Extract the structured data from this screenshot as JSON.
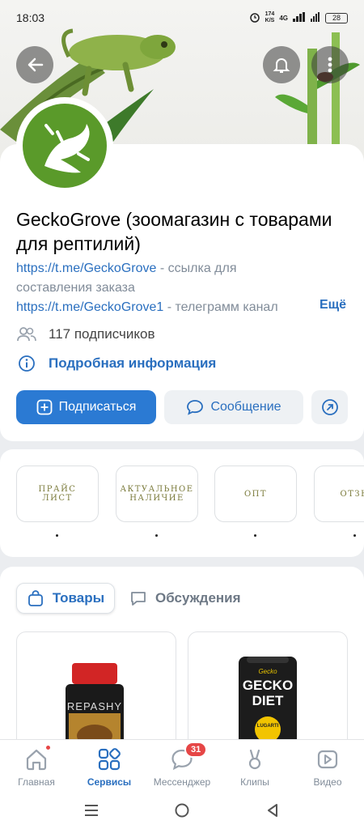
{
  "status_bar": {
    "time": "18:03",
    "net_speed": "174\nK/S",
    "network": "4G",
    "battery": "28"
  },
  "community": {
    "name": "GeckoGrove (зоомагазин с товарами для рептилий)",
    "link1": "https://t.me/GeckoGrove",
    "link1_desc": " - ссылка для составления заказа",
    "link2": "https://t.me/GeckoGrove1",
    "link2_desc": " - телеграмм канал",
    "more": "Ещё",
    "subscribers": "117 подписчиков",
    "details": "Подробная информация"
  },
  "actions": {
    "subscribe": "Подписаться",
    "message": "Сообщение"
  },
  "albums": [
    {
      "label": "ПРАЙС\nЛИСТ",
      "dot": "."
    },
    {
      "label": "АКТУАЛЬНОЕ\nНАЛИЧИЕ",
      "dot": "."
    },
    {
      "label": "ОПТ",
      "dot": "."
    },
    {
      "label": "ОТЗЫ",
      "dot": "."
    }
  ],
  "tabs": {
    "products": "Товары",
    "discussions": "Обсуждения"
  },
  "products": [
    {
      "brand": "REPASHY"
    },
    {
      "brand_small": "Gecko",
      "brand_line1": "GECKO",
      "brand_line2": "DIET",
      "badge": "LUGARTI"
    }
  ],
  "bottom_nav": [
    {
      "label": "Главная"
    },
    {
      "label": "Сервисы"
    },
    {
      "label": "Мессенджер",
      "badge": "31"
    },
    {
      "label": "Клипы"
    },
    {
      "label": "Видео"
    }
  ],
  "colors": {
    "accent": "#2b7ad3",
    "link": "#2a6fbf",
    "badge": "#e64646",
    "avatar_green": "#5a9a2a"
  }
}
